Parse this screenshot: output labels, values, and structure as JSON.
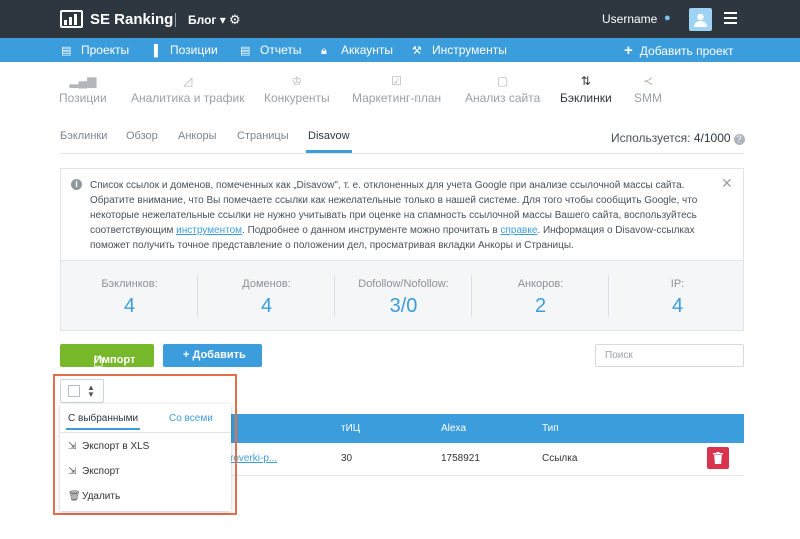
{
  "header": {
    "brand": "SE Ranking",
    "blog": "Блог ▾",
    "username": "Username"
  },
  "nav": {
    "items": [
      "Проекты",
      "Позиции",
      "Отчеты",
      "Аккаунты",
      "Инструменты"
    ],
    "add_project": "Добавить проект"
  },
  "modules": [
    "Позиции",
    "Аналитика и трафик",
    "Конкуренты",
    "Маркетинг-план",
    "Анализ сайта",
    "Бэклинки",
    "SMM"
  ],
  "subtabs": [
    "Бэклинки",
    "Обзор",
    "Анкоры",
    "Страницы",
    "Disavow"
  ],
  "usage": {
    "label": "Используется:",
    "value": "4/1000"
  },
  "info": {
    "text1": "Список ссылок и доменов, помеченных как „Disavow\", т. е. отклоненных для учета Google при анализе ссылочной массы сайта. Обратите внимание, что Вы помечаете ссылки как нежелательные только в нашей системе. Для того чтобы сообщить Google, что некоторые нежелательные ссылки не нужно учитывать при оценке на спамность ссылочной массы Вашего сайта, воспользуйтесь соответствующим ",
    "link1": "инструментом",
    "text2": ". Подробнее о данном инструменте можно прочитать в ",
    "link2": "справке",
    "text3": ". Информация о Disavow-ссылках поможет получить точное представление о положении дел, просматривая вкладки Анкоры и Страницы."
  },
  "stats": [
    {
      "label": "Бэклинков:",
      "value": "4"
    },
    {
      "label": "Доменов:",
      "value": "4"
    },
    {
      "label": "Dofollow/Nofollow:",
      "value": "3/0"
    },
    {
      "label": "Анкоров:",
      "value": "2"
    },
    {
      "label": "IP:",
      "value": "4"
    }
  ],
  "actions": {
    "import": "Импорт",
    "add": "+ Добавить",
    "search_placeholder": "Поиск"
  },
  "table": {
    "columns": [
      "тИЦ",
      "Alexa",
      "Тип"
    ],
    "rows": [
      {
        "url": "roverki-p...",
        "tic": "30",
        "alexa": "1758921",
        "type": "Ссылка"
      }
    ]
  },
  "bulk_menu": {
    "tabs": [
      "С выбранными",
      "Со всеми"
    ],
    "items": [
      "Экспорт в XLS",
      "Экспорт",
      "Удалить"
    ]
  },
  "colors": {
    "topbar": "#2e3740",
    "accent": "#3c9ddc",
    "import_green": "#76b82a",
    "delete_red": "#d9334d",
    "highlight": "#e36e4b"
  }
}
